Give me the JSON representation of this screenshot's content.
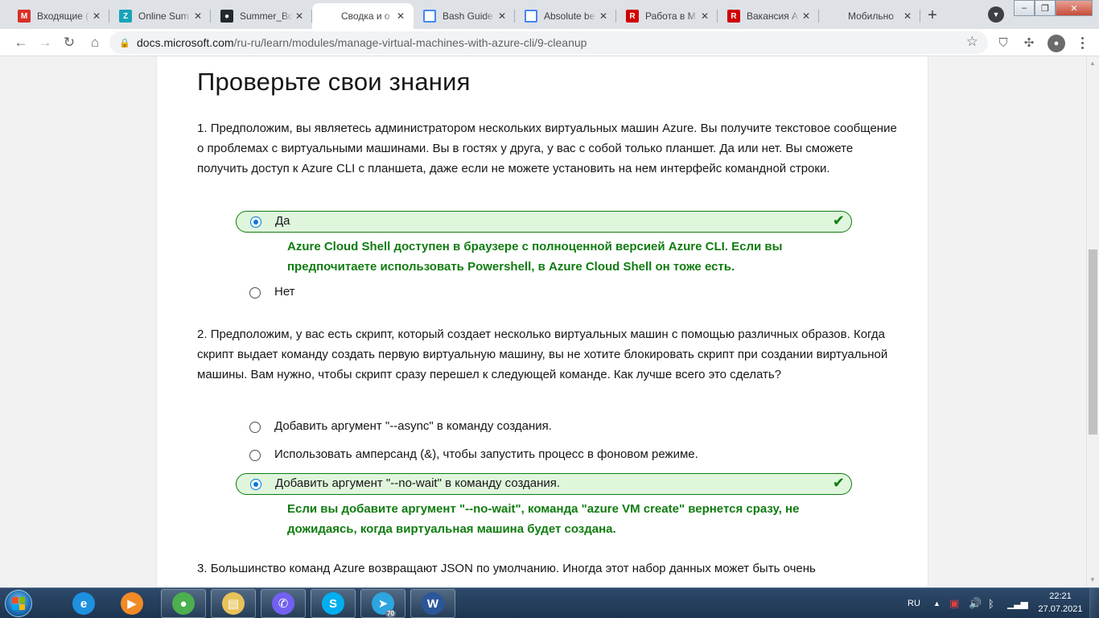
{
  "tabs": [
    {
      "title": "Входящие (",
      "icon": "gmail-icon",
      "color": "#d93025",
      "glyph": "M"
    },
    {
      "title": "Online Sum",
      "icon": "z-icon",
      "color": "#19a3b8",
      "glyph": "Z"
    },
    {
      "title": "Summer_Bo",
      "icon": "github-icon",
      "color": "#24292e",
      "glyph": "●"
    },
    {
      "title": "Сводка и о",
      "icon": "microsoft-icon",
      "color": "#f25022",
      "glyph": "",
      "active": true
    },
    {
      "title": "Bash Guide",
      "icon": "page-icon",
      "color": "#4285f4",
      "glyph": ""
    },
    {
      "title": "Absolute be",
      "icon": "page-icon",
      "color": "#4285f4",
      "glyph": ""
    },
    {
      "title": "Работа в М",
      "icon": "r-icon",
      "color": "#d00000",
      "glyph": "R"
    },
    {
      "title": "Вакансия A",
      "icon": "r-icon",
      "color": "#d00000",
      "glyph": "R"
    },
    {
      "title": "Мобильно",
      "icon": "microsoft-icon",
      "color": "#f25022",
      "glyph": ""
    }
  ],
  "toolbar": {
    "url_host": "docs.microsoft.com",
    "url_path": "/ru-ru/learn/modules/manage-virtual-machines-with-azure-cli/9-cleanup"
  },
  "page": {
    "title": "Проверьте свои знания",
    "questions": [
      {
        "number": "1.",
        "text": "Предположим, вы являетесь администратором нескольких виртуальных машин Azure. Вы получите текстовое сообщение о проблемах с виртуальными машинами. Вы в гостях у друга, у вас с собой только планшет. Да или нет. Вы сможете получить доступ к Azure CLI с планшета, даже если не можете установить на нем интерфейс командной строки.",
        "options": [
          {
            "label": "Да",
            "selected": true,
            "correct": true,
            "feedback": "Azure Cloud Shell доступен в браузере с полноценной версией Azure CLI. Если вы предпочитаете использовать Powershell, в Azure Cloud Shell он тоже есть."
          },
          {
            "label": "Нет",
            "selected": false
          }
        ]
      },
      {
        "number": "2.",
        "text": "Предположим, у вас есть скрипт, который создает несколько виртуальных машин с помощью различных образов. Когда скрипт выдает команду создать первую виртуальную машину, вы не хотите блокировать скрипт при создании виртуальной машины. Вам нужно, чтобы скрипт сразу перешел к следующей команде. Как лучше всего это сделать?",
        "options": [
          {
            "label": "Добавить аргумент \"--async\" в команду создания.",
            "selected": false
          },
          {
            "label": "Использовать амперсанд (&), чтобы запустить процесс в фоновом режиме.",
            "selected": false
          },
          {
            "label": "Добавить аргумент \"--no-wait\" в команду создания.",
            "selected": true,
            "correct": true,
            "feedback": "Если вы добавите аргумент \"--no-wait\", команда \"azure VM create\" вернется сразу, не дожидаясь, когда виртуальная машина будет создана."
          }
        ]
      },
      {
        "number": "3.",
        "text": "Большинство команд Azure возвращают JSON по умолчанию. Иногда этот набор данных может быть очень"
      }
    ]
  },
  "taskbar": {
    "apps": [
      {
        "name": "internet-explorer-icon",
        "color": "#1e90e0",
        "glyph": "e"
      },
      {
        "name": "media-player-icon",
        "color": "#f08a24",
        "glyph": "▶"
      },
      {
        "name": "chrome-icon",
        "color": "#4caf50",
        "glyph": "●"
      },
      {
        "name": "file-explorer-icon",
        "color": "#e8c25a",
        "glyph": "▤"
      },
      {
        "name": "viber-icon",
        "color": "#7360f2",
        "glyph": "✆"
      },
      {
        "name": "skype-icon",
        "color": "#00aff0",
        "glyph": "S"
      },
      {
        "name": "telegram-icon",
        "color": "#2ca5e0",
        "glyph": "➤",
        "badge": "70"
      },
      {
        "name": "word-icon",
        "color": "#2b579a",
        "glyph": "W"
      }
    ],
    "language": "RU",
    "time": "22:21",
    "date": "27.07.2021"
  },
  "colors": {
    "correct_green": "#107c10",
    "correct_bg": "#dff6dd",
    "radio_blue": "#0078d4"
  }
}
